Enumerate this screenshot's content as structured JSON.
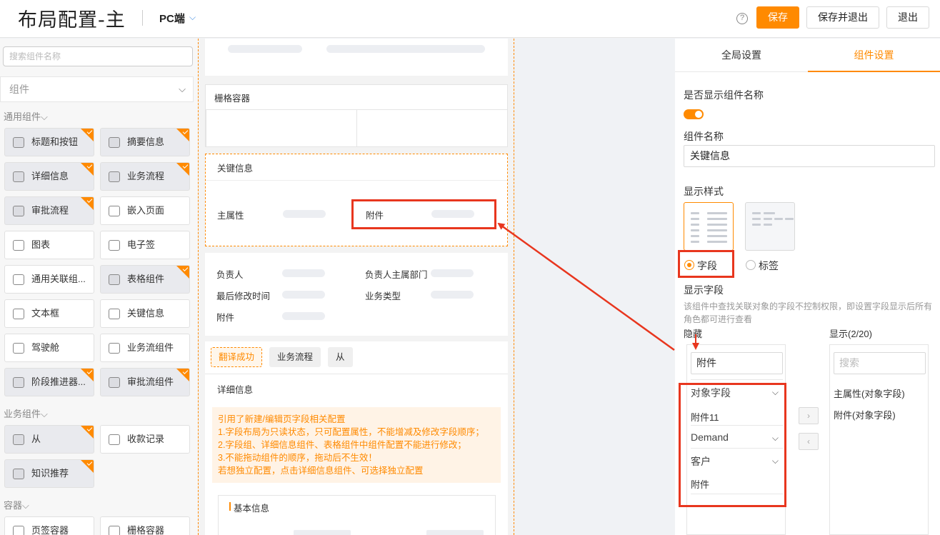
{
  "header": {
    "title": "布局配置-主",
    "platform": "PC端",
    "save_label": "保存",
    "save_exit_label": "保存并退出",
    "exit_label": "退出",
    "help": "?"
  },
  "sidebar": {
    "search_placeholder": "搜索组件名称",
    "category": "组件",
    "groups": {
      "general": "通用组件",
      "business": "业务组件",
      "container": "容器"
    },
    "items": [
      {
        "label": "标题和按钮",
        "used": true
      },
      {
        "label": "摘要信息",
        "used": true
      },
      {
        "label": "详细信息",
        "used": true
      },
      {
        "label": "业务流程",
        "used": true
      },
      {
        "label": "审批流程",
        "used": true
      },
      {
        "label": "嵌入页面",
        "used": false
      },
      {
        "label": "图表",
        "used": false
      },
      {
        "label": "电子签",
        "used": false
      },
      {
        "label": "通用关联组...",
        "used": false
      },
      {
        "label": "表格组件",
        "used": true
      },
      {
        "label": "文本框",
        "used": false
      },
      {
        "label": "关键信息",
        "used": false
      },
      {
        "label": "驾驶舱",
        "used": false
      },
      {
        "label": "业务流组件",
        "used": false
      },
      {
        "label": "阶段推进器...",
        "used": true
      },
      {
        "label": "审批流组件",
        "used": true
      },
      {
        "label": "从",
        "used": true
      },
      {
        "label": "收款记录",
        "used": false
      },
      {
        "label": "知识推荐",
        "used": true
      },
      {
        "label": "页签容器",
        "used": false
      },
      {
        "label": "栅格容器",
        "used": false
      }
    ]
  },
  "canvas": {
    "grid_container": "栅格容器",
    "key_info_title": "关键信息",
    "key_fields": [
      "主属性",
      "附件"
    ],
    "summary_fields": [
      "负责人",
      "负责人主属部门",
      "最后修改时间",
      "业务类型",
      "附件"
    ],
    "tabs": [
      "翻译成功",
      "业务流程",
      "从"
    ],
    "detail_title": "详细信息",
    "notice_lines": [
      "引用了新建/编辑页字段相关配置",
      "1.字段布局为只读状态，只可配置属性，不能增减及修改字段顺序；",
      "2.字段组、详细信息组件、表格组件中组件配置不能进行修改；",
      "3.不能拖动组件的顺序，拖动后不生效！",
      "若想独立配置，点击详细信息组件、可选择独立配置"
    ],
    "basic_info": "基本信息"
  },
  "right_panel": {
    "tabs": [
      "全局设置",
      "组件设置"
    ],
    "active_tab": "组件设置",
    "show_name_label": "是否显示组件名称",
    "show_name_on": true,
    "name_label": "组件名称",
    "name_value": "关键信息",
    "style_label": "显示样式",
    "style_options": [
      "字段",
      "标签"
    ],
    "style_selected": "字段",
    "fields_label": "显示字段",
    "fields_desc": "该组件中查找关联对象的字段不控制权限，即设置字段显示后所有角色都可进行查看",
    "hidden_label": "隐藏",
    "shown_label": "显示(2/20)",
    "hidden_search_value": "附件",
    "shown_search_placeholder": "搜索",
    "hidden_items": [
      {
        "type": "group",
        "label": "对象字段"
      },
      {
        "type": "item",
        "label": "附件11"
      },
      {
        "type": "group",
        "label": "Demand"
      },
      {
        "type": "group",
        "label": "客户"
      },
      {
        "type": "item",
        "label": "附件"
      }
    ],
    "shown_items": [
      "主属性(对象字段)",
      "附件(对象字段)"
    ],
    "move_right": "›",
    "move_left": "‹"
  },
  "colors": {
    "accent": "#ff8a00",
    "annotation": "#e8361e"
  }
}
